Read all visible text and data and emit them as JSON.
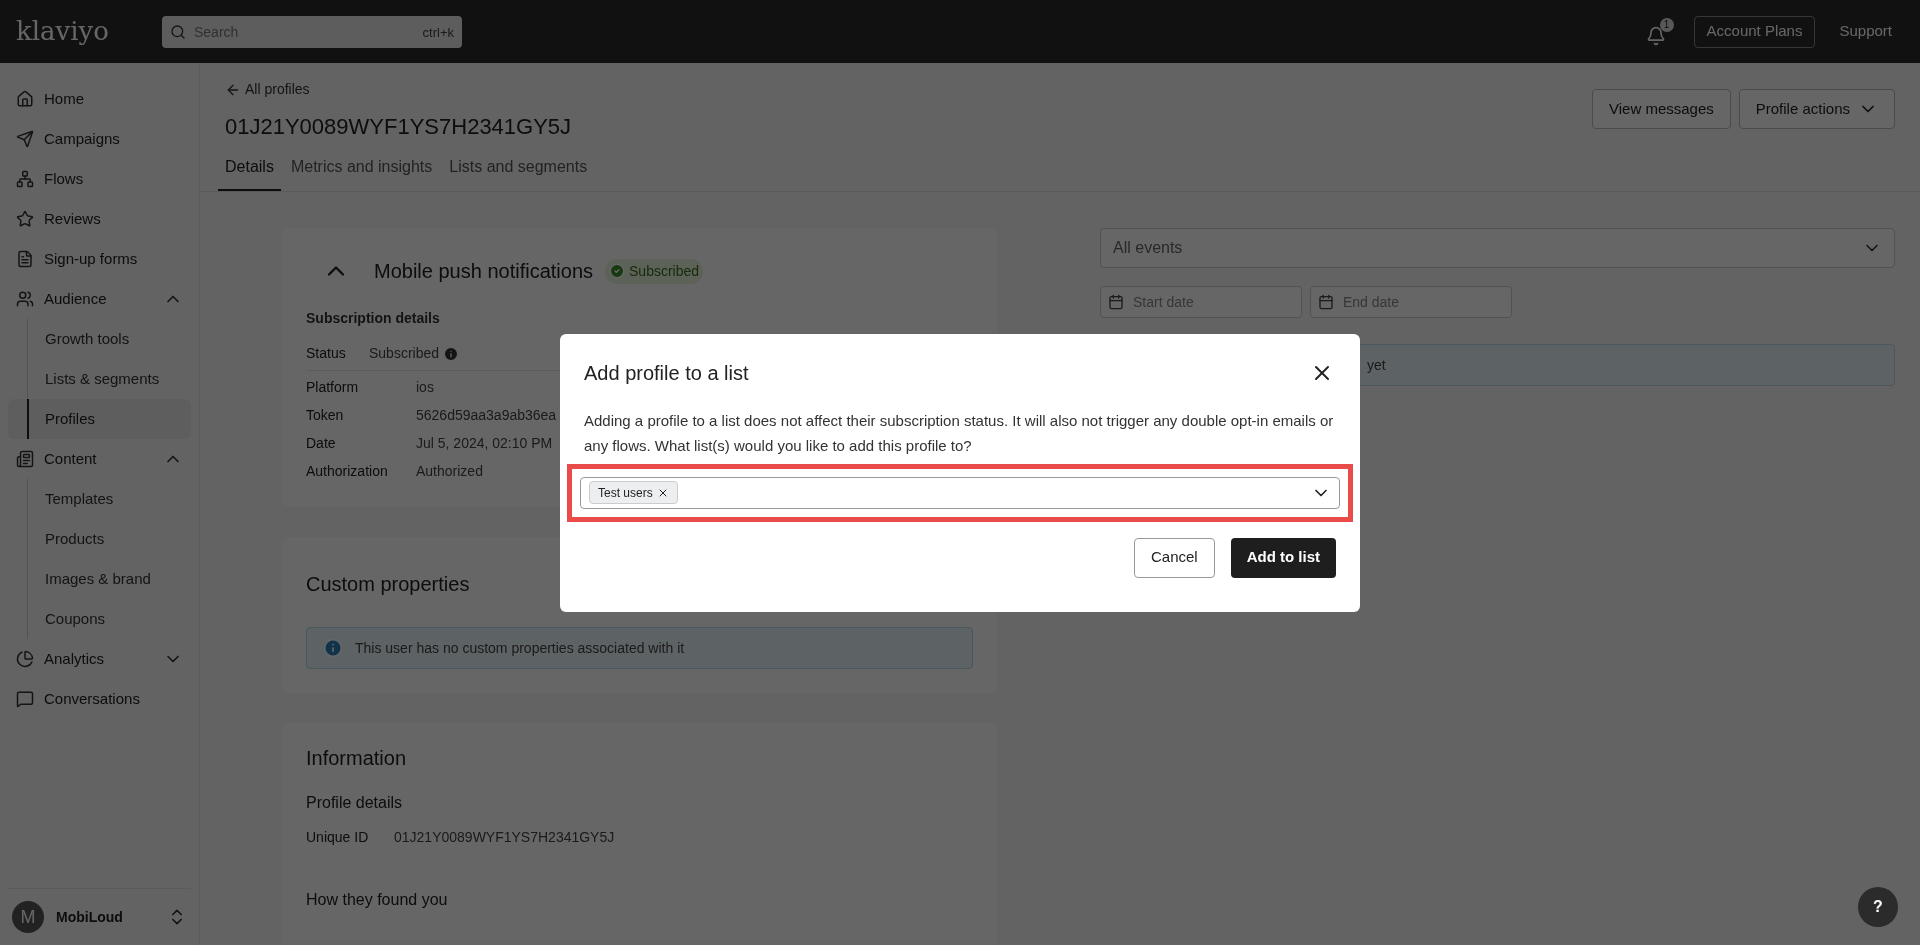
{
  "topbar": {
    "logo": "klaviyo",
    "search_placeholder": "Search",
    "search_shortcut": "ctrl+k",
    "notification_count": "1",
    "buttons": [
      {
        "label": "Account Plans",
        "kind": "outlined"
      },
      {
        "label": "Support",
        "kind": "plain"
      }
    ]
  },
  "sidebar": {
    "items": [
      {
        "label": "Home"
      },
      {
        "label": "Campaigns"
      },
      {
        "label": "Flows"
      },
      {
        "label": "Reviews"
      },
      {
        "label": "Sign-up forms"
      },
      {
        "label": "Audience",
        "expanded": true,
        "children": [
          {
            "label": "Growth tools",
            "selected": false
          },
          {
            "label": "Lists & segments",
            "selected": false
          },
          {
            "label": "Profiles",
            "selected": true
          }
        ]
      },
      {
        "label": "Content",
        "expanded": true,
        "children": [
          {
            "label": "Templates",
            "selected": false
          },
          {
            "label": "Products",
            "selected": false
          },
          {
            "label": "Images & brand",
            "selected": false
          },
          {
            "label": "Coupons",
            "selected": false
          }
        ]
      },
      {
        "label": "Analytics",
        "expanded": false
      },
      {
        "label": "Conversations"
      }
    ],
    "account": {
      "initial": "M",
      "name": "MobiLoud"
    }
  },
  "header": {
    "back_link": "All profiles",
    "title": "01J21Y0089WYF1YS7H2341GY5J",
    "buttons": [
      "View messages",
      "Profile actions"
    ],
    "tabs": [
      {
        "label": "Details",
        "selected": true
      },
      {
        "label": "Metrics and insights",
        "selected": false
      },
      {
        "label": "Lists and segments",
        "selected": false
      }
    ]
  },
  "push_card": {
    "title": "Mobile push notifications",
    "badge": "Subscribed",
    "expanded": true,
    "section": "Subscription details",
    "status": {
      "label": "Status",
      "value": "Subscribed"
    },
    "rows": [
      {
        "label": "Platform",
        "value": "ios"
      },
      {
        "label": "Token",
        "value": "5626d59aa3a9ab36ea"
      },
      {
        "label": "Date",
        "value": "Jul 5, 2024, 02:10 PM"
      },
      {
        "label": "Authorization",
        "value": "Authorized"
      }
    ]
  },
  "custom_card": {
    "title": "Custom properties",
    "notice": "This user has no custom properties associated with it"
  },
  "info_card": {
    "title": "Information",
    "section": "Profile details",
    "rows": [
      {
        "label": "Unique ID",
        "value": "01J21Y0089WYF1YS7H2341GY5J"
      }
    ],
    "section_2": "How they found you"
  },
  "activity": {
    "event_filter": "All events",
    "start_placeholder": "Start date",
    "end_placeholder": "End date",
    "notice": "yet"
  },
  "modal": {
    "title": "Add profile to a list",
    "body": "Adding a profile to a list does not affect their subscription status. It will also not trigger any double opt-in emails or any flows. What list(s) would you like to add this profile to?",
    "highlighted": true,
    "tags": [
      "Test users"
    ],
    "buttons": [
      {
        "label": "Cancel",
        "kind": "secondary"
      },
      {
        "label": "Add to list",
        "kind": "primary"
      }
    ]
  },
  "help_button": "?"
}
